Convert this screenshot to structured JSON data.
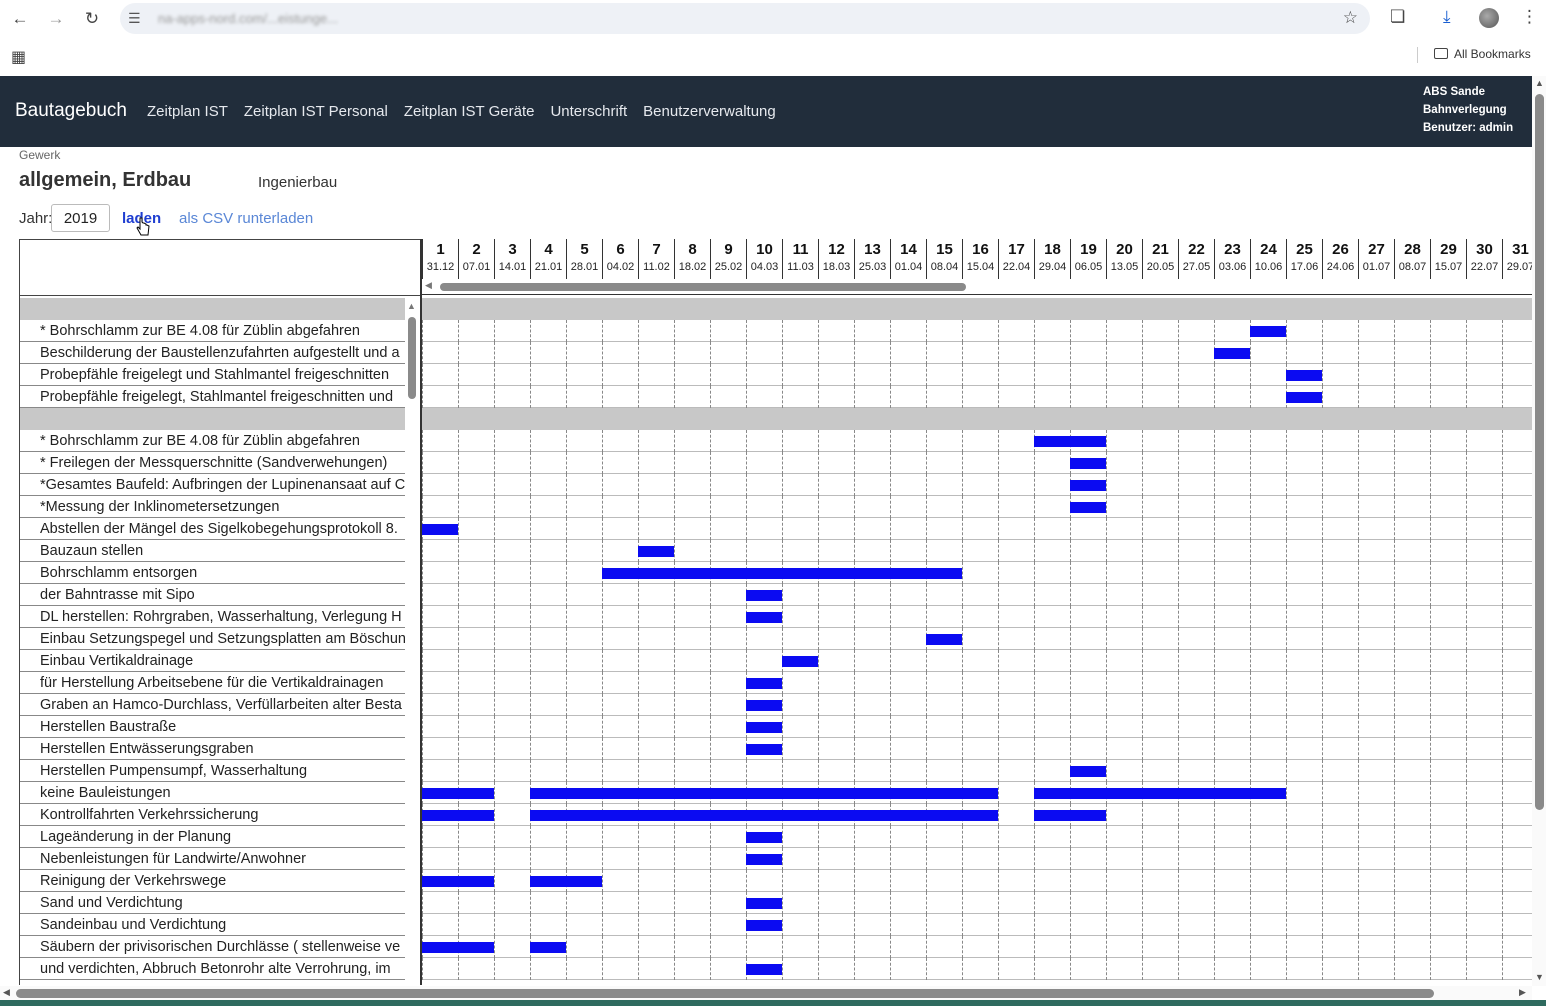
{
  "browser": {
    "url": "na-apps-nord.com/...eistunge..."
  },
  "bookmarks": {
    "all_label": "All Bookmarks"
  },
  "navbar": {
    "brand": "Bautagebuch",
    "links": [
      "Zeitplan IST",
      "Zeitplan IST Personal",
      "Zeitplan IST Geräte",
      "Unterschrift",
      "Benutzerverwaltung"
    ],
    "info": [
      "ABS Sande",
      "Bahnverlegung",
      "Benutzer: admin"
    ]
  },
  "gewerk": {
    "label": "Gewerk",
    "title": "allgemein, Erdbau",
    "sub": "Ingenierbau"
  },
  "controls": {
    "jahr_label": "Jahr:",
    "jahr_value": "2019",
    "laden": "laden",
    "csv": "als CSV runterladen"
  },
  "chart_data": {
    "type": "gantt",
    "columns": [
      {
        "num": "1",
        "date": "31.12"
      },
      {
        "num": "2",
        "date": "07.01"
      },
      {
        "num": "3",
        "date": "14.01"
      },
      {
        "num": "4",
        "date": "21.01"
      },
      {
        "num": "5",
        "date": "28.01"
      },
      {
        "num": "6",
        "date": "04.02"
      },
      {
        "num": "7",
        "date": "11.02"
      },
      {
        "num": "8",
        "date": "18.02"
      },
      {
        "num": "9",
        "date": "25.02"
      },
      {
        "num": "10",
        "date": "04.03"
      },
      {
        "num": "11",
        "date": "11.03"
      },
      {
        "num": "12",
        "date": "18.03"
      },
      {
        "num": "13",
        "date": "25.03"
      },
      {
        "num": "14",
        "date": "01.04"
      },
      {
        "num": "15",
        "date": "08.04"
      },
      {
        "num": "16",
        "date": "15.04"
      },
      {
        "num": "17",
        "date": "22.04"
      },
      {
        "num": "18",
        "date": "29.04"
      },
      {
        "num": "19",
        "date": "06.05"
      },
      {
        "num": "20",
        "date": "13.05"
      },
      {
        "num": "21",
        "date": "20.05"
      },
      {
        "num": "22",
        "date": "27.05"
      },
      {
        "num": "23",
        "date": "03.06"
      },
      {
        "num": "24",
        "date": "10.06"
      },
      {
        "num": "25",
        "date": "17.06"
      },
      {
        "num": "26",
        "date": "24.06"
      },
      {
        "num": "27",
        "date": "01.07"
      },
      {
        "num": "28",
        "date": "08.07"
      },
      {
        "num": "29",
        "date": "15.07"
      },
      {
        "num": "30",
        "date": "22.07"
      },
      {
        "num": "31",
        "date": "29.07"
      }
    ],
    "rows": [
      {
        "group": true,
        "label": ""
      },
      {
        "label": "* Bohrschlamm zur BE 4.08 für Züblin abgefahren",
        "weeks": [
          24
        ]
      },
      {
        "label": "Beschilderung der Baustellenzufahrten aufgestellt und a",
        "weeks": [
          23
        ]
      },
      {
        "label": "Probepfähle freigelegt und Stahlmantel freigeschnitten",
        "weeks": [
          25
        ]
      },
      {
        "label": "Probepfähle freigelegt, Stahlmantel freigeschnitten und",
        "weeks": [
          25
        ]
      },
      {
        "group": true,
        "label": ""
      },
      {
        "label": "* Bohrschlamm zur BE 4.08 für Züblin abgefahren",
        "weeks": [
          18,
          19
        ]
      },
      {
        "label": "* Freilegen der Messquerschnitte (Sandverwehungen)",
        "weeks": [
          19
        ]
      },
      {
        "label": "*Gesamtes Baufeld: Aufbringen der Lupinenansaat auf C",
        "weeks": [
          19
        ]
      },
      {
        "label": "*Messung der Inklinometersetzungen",
        "weeks": [
          19
        ]
      },
      {
        "label": "Abstellen der Mängel des Sigelkobegehungsprotokoll 8.",
        "weeks": [
          1
        ]
      },
      {
        "label": "Bauzaun stellen",
        "weeks": [
          7
        ]
      },
      {
        "label": "Bohrschlamm entsorgen",
        "weeks": [
          6,
          7,
          8,
          9,
          10,
          11,
          12,
          13,
          14,
          15
        ]
      },
      {
        "label": "der Bahntrasse mit Sipo",
        "weeks": [
          10
        ]
      },
      {
        "label": "DL herstellen: Rohrgraben, Wasserhaltung, Verlegung H",
        "weeks": [
          10
        ]
      },
      {
        "label": "Einbau Setzungspegel und Setzungsplatten am Böschun",
        "weeks": [
          15
        ]
      },
      {
        "label": "Einbau Vertikaldrainage",
        "weeks": [
          11
        ]
      },
      {
        "label": "für Herstellung Arbeitsebene für die Vertikaldrainagen",
        "weeks": [
          10
        ]
      },
      {
        "label": "Graben an Hamco-Durchlass, Verfüllarbeiten alter Besta",
        "weeks": [
          10
        ]
      },
      {
        "label": "Herstellen Baustraße",
        "weeks": [
          10
        ]
      },
      {
        "label": "Herstellen Entwässerungsgraben",
        "weeks": [
          10
        ]
      },
      {
        "label": "Herstellen Pumpensumpf, Wasserhaltung",
        "weeks": [
          19
        ]
      },
      {
        "label": "keine Bauleistungen",
        "weeks": [
          1,
          2,
          4,
          5,
          6,
          7,
          8,
          9,
          10,
          11,
          12,
          13,
          14,
          15,
          16,
          18,
          19,
          20,
          21,
          22,
          23,
          24
        ]
      },
      {
        "label": "Kontrollfahrten Verkehrssicherung",
        "weeks": [
          1,
          2,
          4,
          5,
          6,
          7,
          8,
          9,
          10,
          11,
          12,
          13,
          14,
          15,
          16,
          18,
          19
        ]
      },
      {
        "label": "Lageänderung in der Planung",
        "weeks": [
          10
        ]
      },
      {
        "label": "Nebenleistungen für Landwirte/Anwohner",
        "weeks": [
          10
        ]
      },
      {
        "label": "Reinigung der Verkehrswege",
        "weeks": [
          1,
          2,
          4,
          5
        ]
      },
      {
        "label": "Sand und Verdichtung",
        "weeks": [
          10
        ]
      },
      {
        "label": "Sandeinbau und Verdichtung",
        "weeks": [
          10
        ]
      },
      {
        "label": "Säubern der privisorischen Durchlässe ( stellenweise ve",
        "weeks": [
          1,
          2,
          4
        ]
      },
      {
        "label": "und verdichten, Abbruch Betonrohr alte Verrohrung, im",
        "weeks": [
          10
        ]
      }
    ],
    "bar_color": "#0b0bf2",
    "group_color": "#c8c8c8"
  }
}
